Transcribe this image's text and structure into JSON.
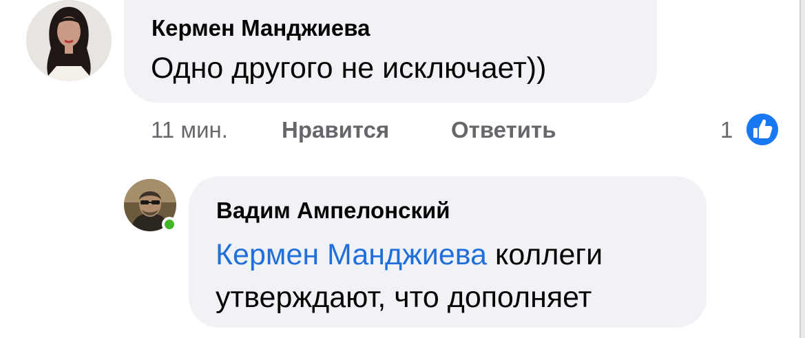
{
  "comment": {
    "author": "Кермен Манджиева",
    "text": "Одно другого не исключает))",
    "time": "11 мин.",
    "like_label": "Нравится",
    "reply_label": "Ответить",
    "reaction_count": "1",
    "reaction_icon": "like-thumbs-up-icon"
  },
  "reply": {
    "author": "Вадим Ампелонский",
    "mention": "Кермен Манджиева",
    "text": "коллеги утверждают, что дополняет",
    "online": true
  },
  "colors": {
    "bubble": "#f0f2f5",
    "text": "#050505",
    "meta": "#65676b",
    "mention": "#216fdb",
    "like_badge": "#1877f2",
    "online": "#42b72a"
  }
}
